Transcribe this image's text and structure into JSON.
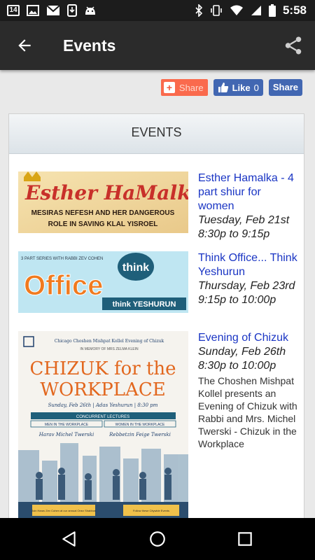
{
  "status_bar": {
    "notification_count": "14",
    "time": "5:58"
  },
  "app_bar": {
    "title": "Events"
  },
  "share_bar": {
    "addthis_label": "Share",
    "like_label": "Like",
    "like_count": "0",
    "fb_share_label": "Share"
  },
  "panel": {
    "header": "EVENTS"
  },
  "events": [
    {
      "title": "Esther Hamalka - 4 part shiur for women",
      "date": "Tuesday, Feb 21st 8:30p to 9:15p",
      "description": "",
      "image": {
        "title": "Esther HaMalka",
        "subtitle_line1": "MESIRAS NEFESH AND HER DANGEROUS",
        "subtitle_line2": "ROLE IN SAVING KLAL YISROEL"
      }
    },
    {
      "title": "Think Office... Think Yeshurun",
      "date": "Thursday, Feb 23rd 9:15p to 10:00p",
      "description": "",
      "image": {
        "top_line": "3 PART SERIES WITH RABBI ZEV COHEN",
        "bubble": "think",
        "main": "Office",
        "bottom": "think YESHURUN"
      }
    },
    {
      "title": "Evening of Chizuk",
      "date": "Sunday, Feb 26th 8:30p to 10:00p",
      "description": "The Choshen Mishpat Kollel presents an Evening of Chizuk with Rabbi and Mrs. Michel Twerski - Chizuk in the Workplace",
      "image": {
        "top_line": "Chicago Choshen Mishpat Kollel Evening of Chizuk",
        "memory_line": "IN MEMORY OF MRS ZELMA KLEIN",
        "title_line1": "CHIZUK for the",
        "title_line2": "WORKPLACE",
        "date_line": "Sunday, Feb 26th | Adas Yeshurun | 8:30 pm",
        "concurrent": "CONCURRENT LECTURES",
        "men_label": "MEN IN THE WORKPLACE",
        "women_label": "WOMEN IN THE WORKPLACE",
        "men_presenter": "Harav Michel Twerski",
        "women_presenter": "Rebbetzin Feige Twerski",
        "footer_left": "Join Harav Zev Cohen at our annual Onez Shabbos",
        "footer_right": "Follow these Citywide Events"
      }
    }
  ],
  "colors": {
    "app_bar": "#2b2b2b",
    "link": "#1a35c4",
    "facebook": "#4267b2",
    "addthis": "#fa6a4d"
  }
}
